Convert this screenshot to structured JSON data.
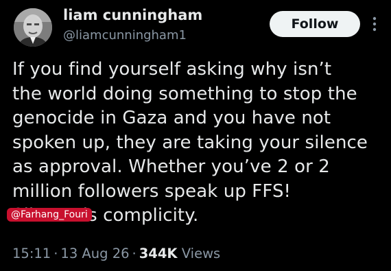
{
  "author": {
    "name": "liam cunningham",
    "handle": "@liamcunningham1"
  },
  "follow_label": "Follow",
  "tweet": {
    "text": "If you find yourself asking why isn’t\nthe world doing something to stop the\ngenocide in Gaza and you have not\nspoken up, they are taking your silence\nas approval. Whether you’ve 2 or 2\nmillion followers speak up FFS!\nSilence is complicity."
  },
  "meta": {
    "time": "15:11",
    "date": "13 Aug 26",
    "separator": "·",
    "views_count": "344K",
    "views_label": "Views"
  },
  "watermark": "@Farhang_Fouri",
  "icons": {
    "avatar": "profile-photo",
    "more": "more-vertical-icon"
  },
  "colors": {
    "background": "#000000",
    "text": "#e7e9ea",
    "secondary_text": "#8b98a5",
    "follow_bg": "#eff3f4",
    "watermark_bg": "#c8102e"
  }
}
